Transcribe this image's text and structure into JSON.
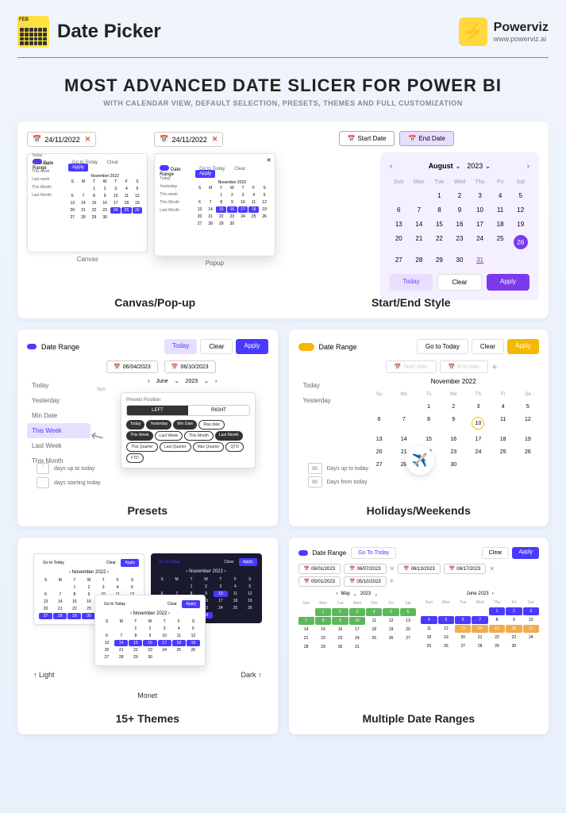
{
  "header": {
    "title": "Date Picker",
    "brand": "Powerviz",
    "url": "www.powerviz.ai"
  },
  "hero": {
    "title": "MOST ADVANCED DATE SLICER FOR POWER BI",
    "subtitle": "WITH CALENDAR VIEW, DEFAULT SELECTION, PRESETS, THEMES AND FULL CUSTOMIZATION"
  },
  "cards": {
    "c1": {
      "title": "Canvas/Pop-up",
      "date": "24/11/2022",
      "canvas_label": "Canvas",
      "popup_label": "Popup",
      "range_label": "Date Range",
      "goto": "Go to Today",
      "clear": "Clear",
      "apply": "Apply",
      "month": "November 2022",
      "presets": [
        "Today",
        "Yesterday",
        "This week",
        "Last week",
        "This Month",
        "Last Month"
      ],
      "days_up": "Days up to today",
      "days_from": "Days From Today"
    },
    "c2": {
      "title": "Start/End Style",
      "start": "Start Date",
      "end": "End Date",
      "month": "August",
      "year": "2023",
      "dow": [
        "Sun",
        "Mon",
        "Tue",
        "Wed",
        "Thu",
        "Fri",
        "Sat"
      ],
      "today": "Today",
      "clear": "Clear",
      "apply": "Apply"
    },
    "c3": {
      "title": "Presets",
      "range_label": "Date Range",
      "today": "Today",
      "clear": "Clear",
      "apply": "Apply",
      "date1": "06/04/2023",
      "date2": "06/10/2023",
      "month": "June",
      "year": "2023",
      "presets": [
        "Today",
        "Yesterday",
        "Min Date",
        "This Week",
        "Last Week",
        "This Month"
      ],
      "days_up": "days up to today",
      "days_start": "days starting today",
      "popup_title": "Presets Position",
      "left": "LEFT",
      "right": "RIGHT",
      "chips": [
        "Today",
        "Yesterday",
        "Min Date",
        "Max date",
        "This Week",
        "Last Week",
        "This Month",
        "Last Month",
        "This Quarter",
        "Last Quarter",
        "Max Quarter",
        "QTD",
        "FTD"
      ]
    },
    "c4": {
      "title": "Holidays/Weekends",
      "range_label": "Date Range",
      "goto": "Go to Today",
      "clear": "Clear",
      "apply": "Apply",
      "start_ph": "Start date",
      "end_ph": "End date",
      "presets": [
        "Today",
        "Yesterday"
      ],
      "month": "November 2022",
      "dow": [
        "Su",
        "Mo",
        "Tu",
        "We",
        "Th",
        "Fr",
        "Sa"
      ],
      "days_up": "Days up to today",
      "days_from": "Days from today",
      "zero": "00"
    },
    "c5": {
      "title": "15+ Themes",
      "light": "↑ Light",
      "dark": "Dark ↑",
      "monet": "Monet",
      "goto": "Go to Today",
      "clear": "Clear",
      "apply": "Apply",
      "month": "November 2022"
    },
    "c6": {
      "title": "Multiple Date Ranges",
      "range_label": "Date Range",
      "goto": "Go To Today",
      "clear": "Clear",
      "apply": "Apply",
      "ranges": [
        {
          "start": "06/01/2023",
          "end": "06/07/2023"
        },
        {
          "start": "06/13/2023",
          "end": "06/17/2023"
        },
        {
          "start": "05/01/2023",
          "end": "05/10/2023"
        }
      ],
      "may": "May",
      "june": "June 2023",
      "year": "2023",
      "dow": [
        "Sun",
        "Mon",
        "Tue",
        "Wed",
        "Thu",
        "Fri",
        "Sat"
      ]
    }
  }
}
